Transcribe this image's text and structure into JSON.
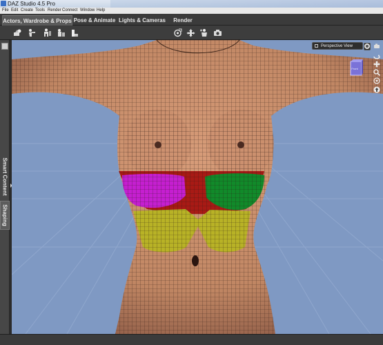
{
  "window": {
    "title": "DAZ Studio 4.5 Pro"
  },
  "menu": [
    "File",
    "Edit",
    "Create",
    "Tools",
    "Render",
    "Connect",
    "Window",
    "Help"
  ],
  "tabs": [
    {
      "label": "Actors, Wardrobe & Props",
      "active": true
    },
    {
      "label": "Pose & Animate",
      "active": false
    },
    {
      "label": "Lights & Cameras",
      "active": false
    },
    {
      "label": "Render",
      "active": false
    }
  ],
  "toolbar": {
    "left_icons": [
      "load-figure-icon",
      "pose-figure-icon",
      "figure-shape-icon",
      "wardrobe-icon",
      "prop-icon"
    ],
    "center_icons": [
      "target-tool-icon",
      "translate-tool-icon",
      "figure-pose-tool-icon",
      "render-camera-icon"
    ]
  },
  "side_tabs": {
    "smart_content": "Smart Content",
    "shaping": "Shaping"
  },
  "viewport": {
    "view_label": "Perspective View",
    "cube_label": "Front",
    "nav_icons": [
      "aux-view-icon",
      "orbit-icon",
      "pan-icon",
      "zoom-icon",
      "frame-icon",
      "reset-view-icon"
    ]
  },
  "colors": {
    "background": "#7f99c3",
    "skin": "#c98f6e",
    "region_magenta": "#c51fd0",
    "region_green": "#118a2a",
    "region_red": "#a81a15",
    "region_yellow": "#b8b226"
  }
}
